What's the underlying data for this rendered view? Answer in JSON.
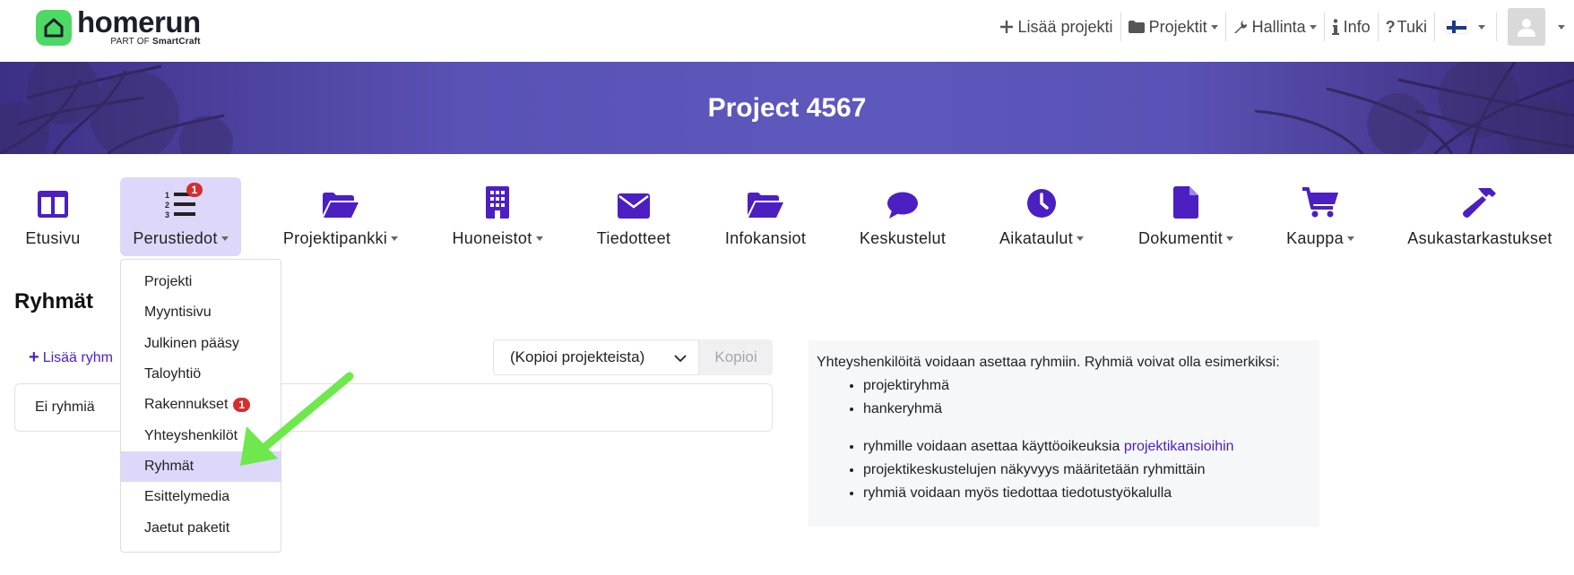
{
  "brand": {
    "name": "homerun",
    "sub_prefix": "PART OF",
    "sub_brand": "SmartCraft"
  },
  "topnav": {
    "add_project": "Lisää projekti",
    "projects": "Projektit",
    "admin": "Hallinta",
    "info": "Info",
    "help": "Tuki"
  },
  "banner": {
    "title": "Project 4567"
  },
  "modules": [
    {
      "label": "Etusivu",
      "icon": "columns-icon"
    },
    {
      "label": "Perustiedot",
      "icon": "list-ol-icon",
      "badge": "1"
    },
    {
      "label": "Projektipankki",
      "icon": "folder-open-icon"
    },
    {
      "label": "Huoneistot",
      "icon": "building-icon"
    },
    {
      "label": "Tiedotteet",
      "icon": "envelope-icon"
    },
    {
      "label": "Infokansiot",
      "icon": "folder-open-icon"
    },
    {
      "label": "Keskustelut",
      "icon": "comment-icon"
    },
    {
      "label": "Aikataulut",
      "icon": "clock-icon"
    },
    {
      "label": "Dokumentit",
      "icon": "file-icon"
    },
    {
      "label": "Kauppa",
      "icon": "shopping-cart-icon"
    },
    {
      "label": "Asukastarkastukset",
      "icon": "hammer-icon"
    }
  ],
  "dropdown": {
    "items": [
      "Projekti",
      "Myyntisivu",
      "Julkinen pääsy",
      "Taloyhtiö",
      "Rakennukset",
      "Yhteyshenkilöt",
      "Ryhmät",
      "Esittelymedia",
      "Jaetut paketit"
    ],
    "rakennukset_badge": "1",
    "selected": "Ryhmät"
  },
  "page": {
    "title": "Ryhmät",
    "add_group": "Lisää ryhm",
    "copy_select_value": "(Kopioi projekteista)",
    "copy_button": "Kopioi",
    "empty_text": "Ei ryhmiä"
  },
  "info": {
    "intro": "Yhteyshenkilöitä voidaan asettaa ryhmiin. Ryhmiä voivat olla esimerkiksi:",
    "list1": [
      "projektiryhmä",
      "hankeryhmä"
    ],
    "list2_item1_text": "ryhmille voidaan asettaa käyttöoikeuksia ",
    "list2_item1_link": "projektikansioihin",
    "list2_item2": "projektikeskustelujen näkyvyys määritetään ryhmittäin",
    "list2_item3": "ryhmiä voidaan myös tiedottaa tiedotustyökalulla"
  },
  "colors": {
    "accent": "#4b1fc2",
    "active_bg": "#ddd8fa",
    "arrow": "#6ee84c",
    "badge": "#d32f2f"
  }
}
